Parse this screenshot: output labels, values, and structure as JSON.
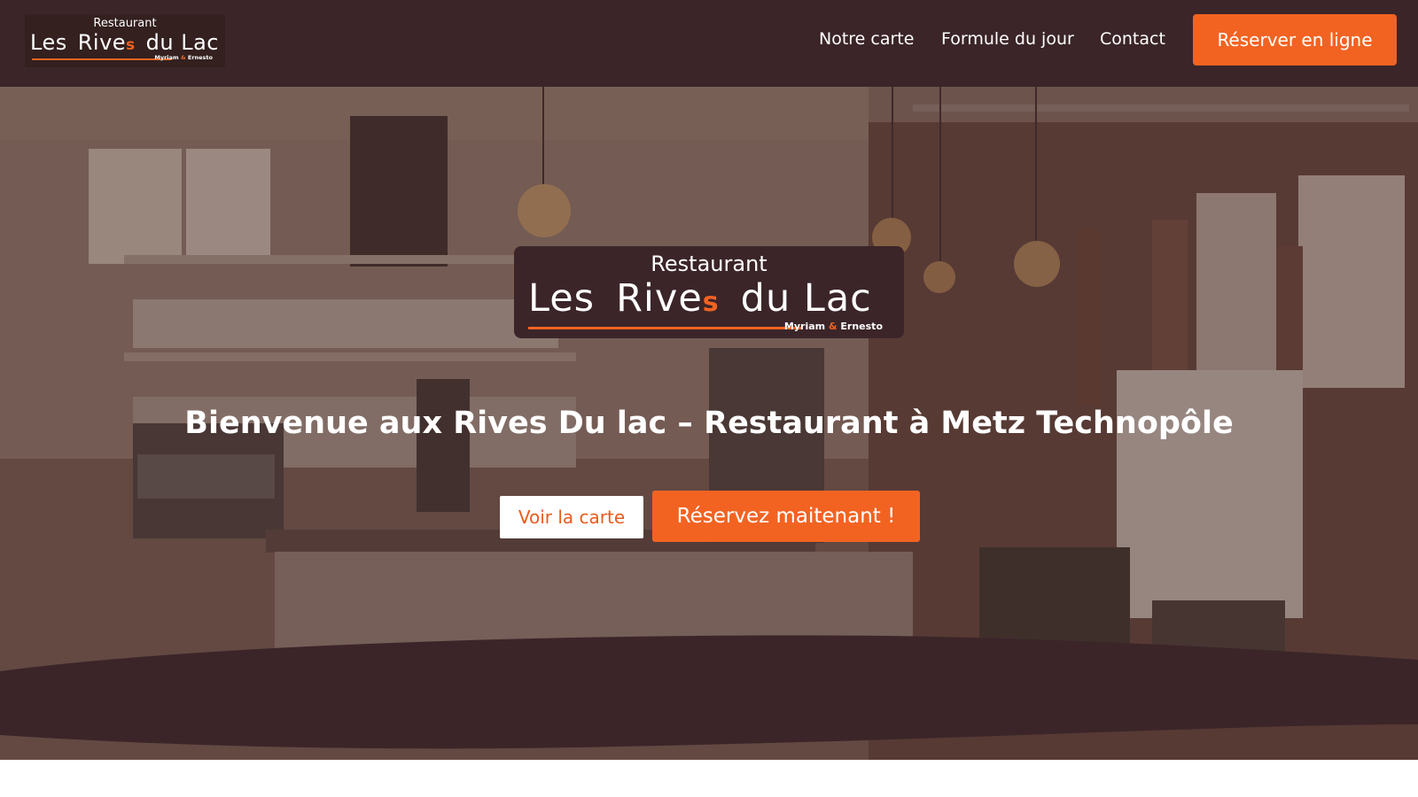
{
  "brand": {
    "top": "Restaurant",
    "word1": "Les",
    "word2": "Rive",
    "mark": "s",
    "word3": "du Lac",
    "owners_a": "Myriam",
    "owners_amp": "&",
    "owners_b": "Ernesto"
  },
  "nav": {
    "items": [
      "Notre carte",
      "Formule du jour",
      "Contact"
    ],
    "cta": "Réserver en ligne"
  },
  "hero": {
    "title": "Bienvenue aux Rives Du lac – Restaurant à Metz Technopôle",
    "btn_primary": "Voir la carte",
    "btn_secondary": "Réservez maitenant !"
  },
  "colors": {
    "header_bg": "#3b2529",
    "accent": "#f26322",
    "wave": "#3b2529"
  }
}
